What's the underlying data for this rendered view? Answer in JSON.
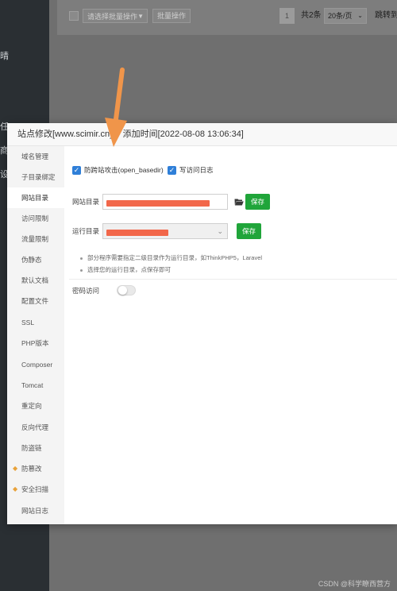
{
  "background": {
    "sidebar_fragments": [
      "晴",
      "任",
      "商",
      "设"
    ],
    "batch_select_placeholder": "请选择批量操作",
    "batch_button_label": "批量操作",
    "pagination": {
      "current_page": "1",
      "total": "共2条",
      "per_page": "20条/页",
      "jump_label": "跳转到"
    }
  },
  "modal": {
    "title": "站点修改[www.scimir.cn] -- 添加时间[2022-08-08 13:06:34]",
    "nav_items": [
      {
        "label": "域名管理"
      },
      {
        "label": "子目录绑定"
      },
      {
        "label": "网站目录",
        "active": true
      },
      {
        "label": "访问限制"
      },
      {
        "label": "流量限制"
      },
      {
        "label": "伪静态"
      },
      {
        "label": "默认文档"
      },
      {
        "label": "配置文件"
      },
      {
        "label": "SSL"
      },
      {
        "label": "PHP版本"
      },
      {
        "label": "Composer"
      },
      {
        "label": "Tomcat"
      },
      {
        "label": "重定向"
      },
      {
        "label": "反向代理"
      },
      {
        "label": "防盗链"
      },
      {
        "label": "防篡改",
        "icon": "gem-icon"
      },
      {
        "label": "安全扫描",
        "icon": "gem-icon"
      },
      {
        "label": "网站日志"
      }
    ],
    "content": {
      "open_basedir_label": "防跨站攻击(open_basedir)",
      "open_basedir_checked": true,
      "access_log_label": "写访问日志",
      "access_log_checked": true,
      "site_dir_label": "网站目录",
      "site_dir_save": "保存",
      "run_dir_label": "运行目录",
      "run_dir_save": "保存",
      "tips": [
        "部分程序需要指定二级目录作为运行目录，如ThinkPHP5，Laravel",
        "选择您的运行目录，点保存即可"
      ],
      "password_access_label": "密码访问",
      "password_access_enabled": false
    }
  },
  "colors": {
    "primary_green": "#20a53a",
    "checkbox_blue": "#2f7fd8",
    "annotation_arrow": "#f0954a",
    "redaction": "#f2674a"
  },
  "watermark": "CSDN @科学瞭西营方"
}
